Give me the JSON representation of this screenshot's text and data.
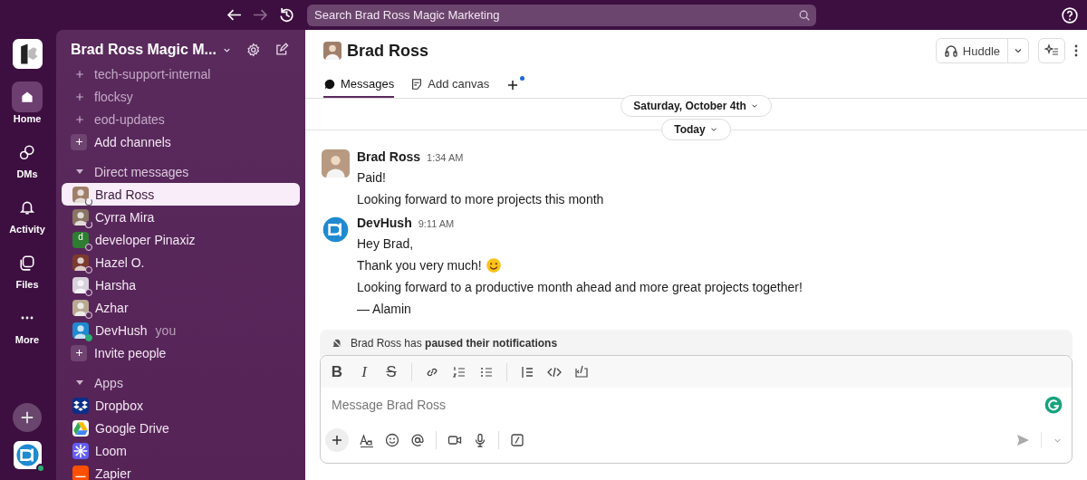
{
  "topbar": {
    "search": {
      "placeholder": "Search Brad Ross Magic Marketing"
    }
  },
  "rail": {
    "items": [
      {
        "label": "Home",
        "kind": "home",
        "selected": true
      },
      {
        "label": "DMs",
        "kind": "dms",
        "selected": false
      },
      {
        "label": "Activity",
        "kind": "bell",
        "selected": false
      },
      {
        "label": "Files",
        "kind": "files",
        "selected": false
      },
      {
        "label": "More",
        "kind": "more",
        "selected": false
      }
    ]
  },
  "sidebar": {
    "workspace": "Brad Ross Magic M...",
    "channels": [
      {
        "name": "tech-support-internal"
      },
      {
        "name": "flocksy"
      },
      {
        "name": "eod-updates"
      }
    ],
    "add_channels": "Add channels",
    "dm_header": {
      "label": "Direct messages",
      "expanded": true
    },
    "dms": [
      {
        "name": "Brad Ross",
        "active": false,
        "paused": true,
        "selected": true
      },
      {
        "name": "Cyrra Mira",
        "active": false,
        "paused": true,
        "selected": false
      },
      {
        "name": "developer Pinaxiz",
        "active": false,
        "paused": false,
        "initial": "d",
        "selected": false
      },
      {
        "name": "Hazel O.",
        "active": false,
        "paused": false,
        "selected": false
      },
      {
        "name": "Harsha",
        "active": false,
        "paused": false,
        "selected": false
      },
      {
        "name": "Azhar",
        "active": false,
        "paused": false,
        "selected": false
      },
      {
        "name": "DevHush",
        "active": true,
        "paused": false,
        "note": "you",
        "selected": false
      }
    ],
    "invite": "Invite people",
    "apps_header": {
      "label": "Apps",
      "expanded": true
    },
    "apps": [
      {
        "name": "Dropbox",
        "kind": "dropbox"
      },
      {
        "name": "Google Drive",
        "kind": "drive"
      },
      {
        "name": "Loom",
        "kind": "loom"
      },
      {
        "name": "Zapier",
        "kind": "zapier"
      }
    ]
  },
  "channel": {
    "title": "Brad Ross",
    "huddle": "Huddle",
    "tabs": [
      {
        "label": "Messages",
        "kind": "bubble",
        "selected": true
      },
      {
        "label": "Add canvas",
        "kind": "canvas",
        "selected": false
      }
    ],
    "dividers": [
      "Saturday, October 4th",
      "Today"
    ],
    "messages": [
      {
        "author": "Brad Ross",
        "kind": "photo",
        "time": "1:34 AM",
        "lines": [
          {
            "text": "Paid!",
            "kind": "text"
          },
          {
            "text": "Looking forward to more projects this month",
            "kind": "text"
          }
        ]
      },
      {
        "author": "DevHush",
        "kind": "logo",
        "time": "9:11 AM",
        "lines": [
          {
            "text": "Hey Brad,",
            "kind": "text"
          },
          {
            "text": "Thank you very much!",
            "kind": "smile"
          },
          {
            "text": "Looking forward to a productive month ahead and more great projects together!",
            "kind": "text"
          },
          {
            "text": "— Alamin",
            "kind": "text"
          }
        ]
      }
    ],
    "banner": "Brad Ross has **paused their notifications**",
    "composer": {
      "format": [
        {
          "glyph": "B",
          "kind": "bold"
        },
        {
          "glyph": "I",
          "kind": "italic"
        },
        {
          "glyph": "S",
          "kind": "strike"
        }
      ],
      "placeholder": "Message Brad Ross"
    }
  }
}
